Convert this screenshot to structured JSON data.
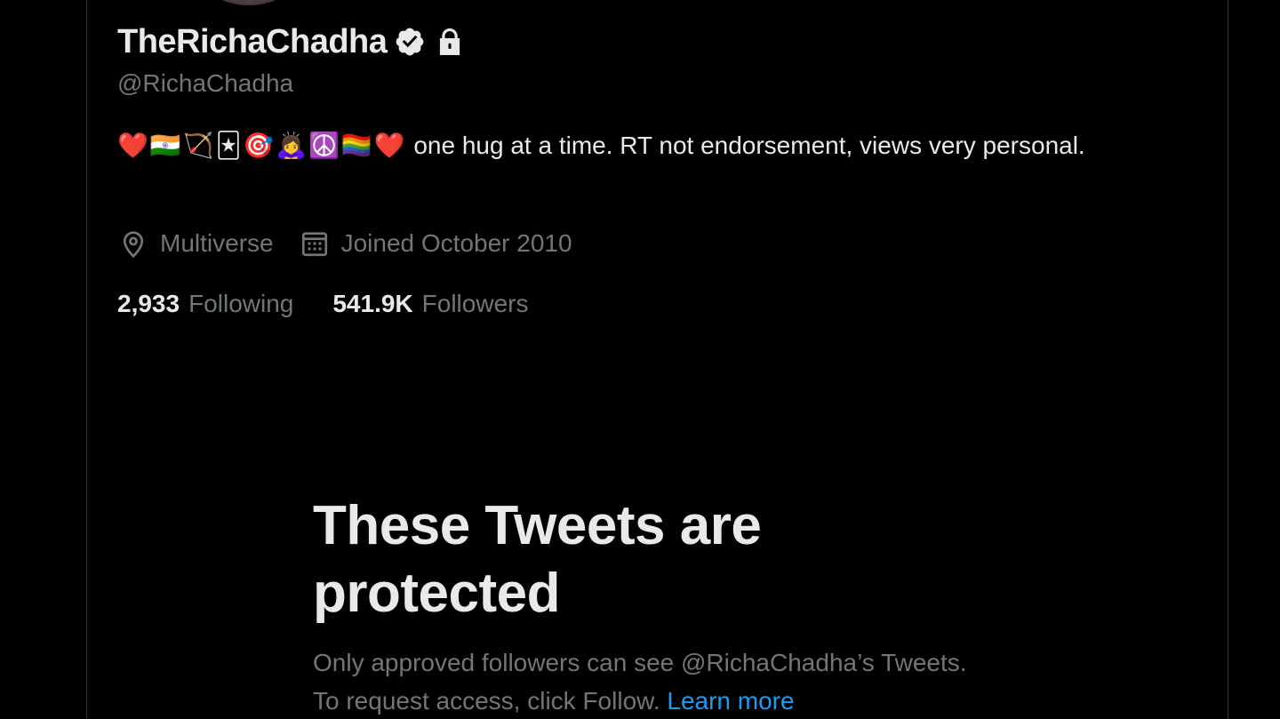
{
  "profile": {
    "display_name": "TheRichaChadha",
    "handle": "@RichaChadha",
    "bio_emojis": "❤️🇮🇳🏹🃏🎯🙇‍♀️☮️🏳️‍🌈❤️",
    "bio_text": "one hug at a time. RT not endorsement, views very personal.",
    "location": "Multiverse",
    "joined": "Joined October 2010",
    "following_count": "2,933",
    "following_label": "Following",
    "followers_count": "541.9K",
    "followers_label": "Followers"
  },
  "icons": {
    "verified": "verified-badge-icon",
    "protected": "lock-icon",
    "location": "location-pin-icon",
    "joined": "calendar-icon"
  },
  "protected_notice": {
    "title": "These Tweets are protected",
    "description": "Only approved followers can see @RichaChadha’s Tweets. To request access, click Follow.",
    "link": "Learn more"
  },
  "colors": {
    "background": "#000000",
    "primary_text": "#e7e9ea",
    "secondary_text": "#71767b",
    "link": "#1d9bf0",
    "border": "#2f3336"
  }
}
